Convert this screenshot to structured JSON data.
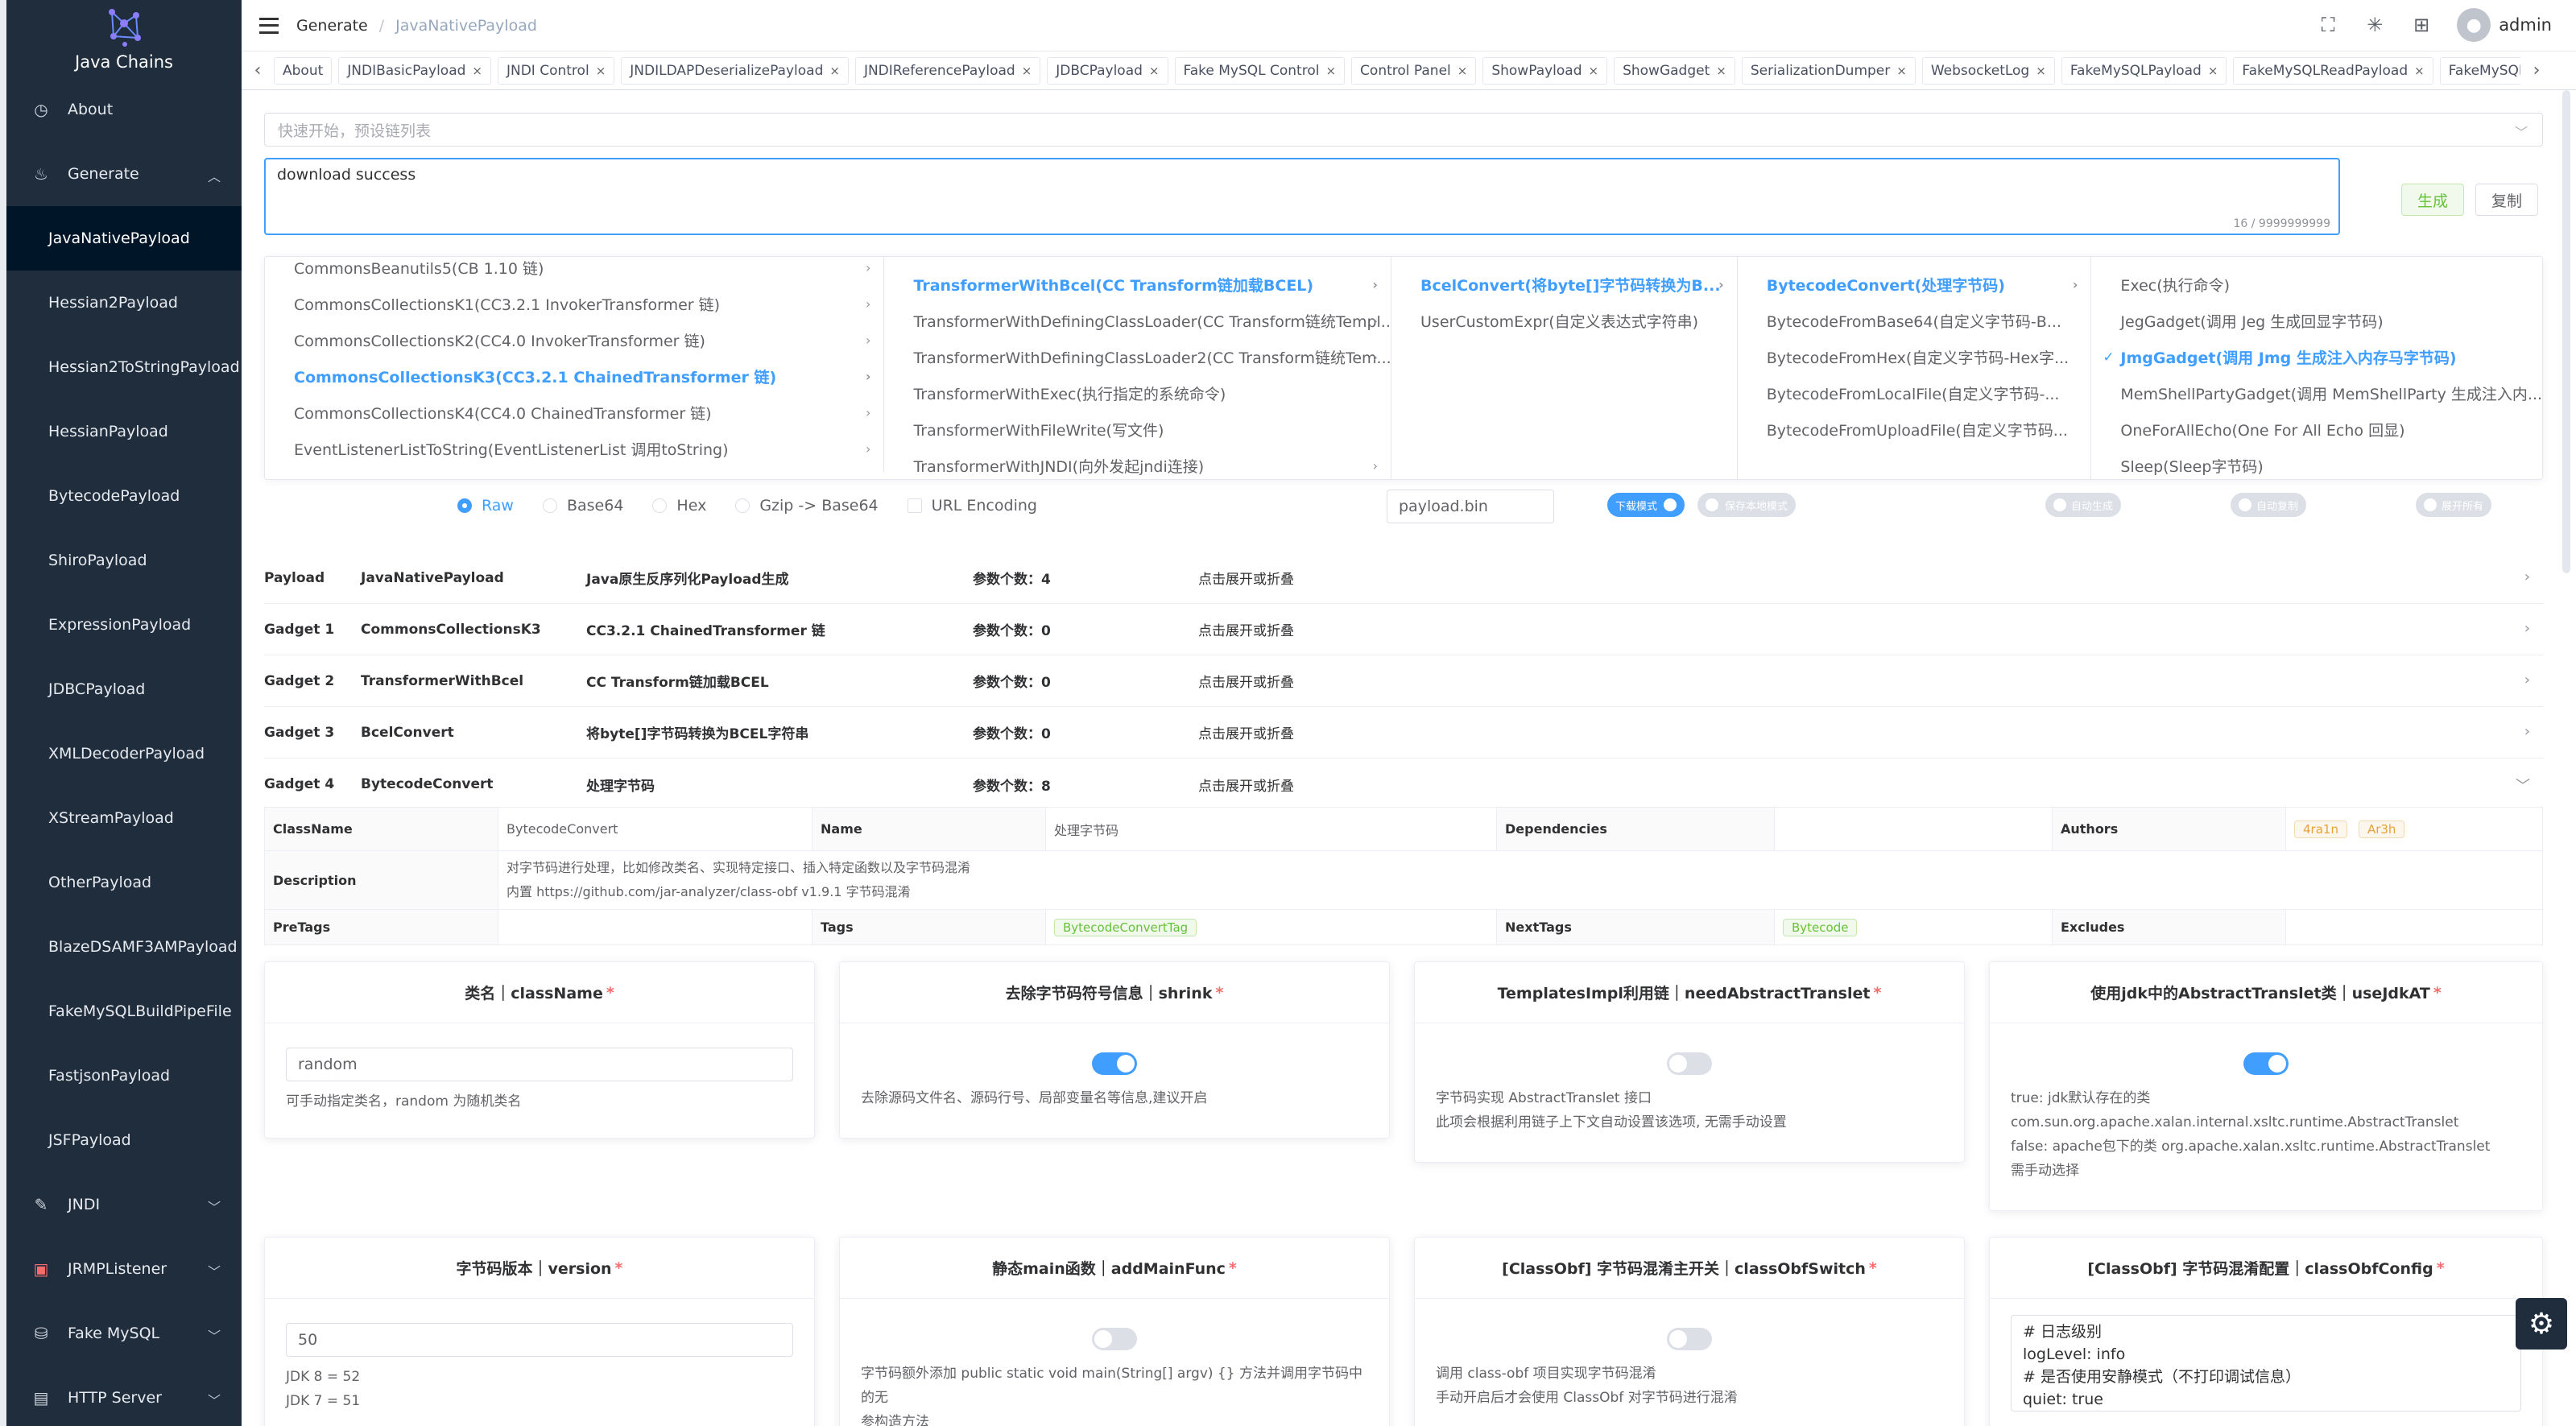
{
  "app": {
    "logo_text": "Java Chains",
    "user": "admin"
  },
  "sidebar": {
    "about": "About",
    "generate": "Generate",
    "sub_items": [
      "JavaNativePayload",
      "Hessian2Payload",
      "Hessian2ToStringPayload",
      "HessianPayload",
      "BytecodePayload",
      "ShiroPayload",
      "ExpressionPayload",
      "JDBCPayload",
      "XMLDecoderPayload",
      "XStreamPayload",
      "OtherPayload",
      "BlazeDSAMF3AMPayload",
      "FakeMySQLBuildPipeFile",
      "FastjsonPayload",
      "JSFPayload"
    ],
    "jndi": "JNDI",
    "jrmp": "JRMPListener",
    "fakemysql": "Fake MySQL",
    "http": "HTTP Server"
  },
  "breadcrumb": {
    "level1": "Generate",
    "level2": "JavaNativePayload"
  },
  "tags": [
    "About",
    "JNDIBasicPayload",
    "JNDI Control",
    "JNDILDAPDeserializePayload",
    "JNDIReferencePayload",
    "JDBCPayload",
    "Fake MySQL Control",
    "Control Panel",
    "ShowPayload",
    "ShowGadget",
    "SerializationDumper",
    "WebsocketLog",
    "FakeMySQLPayload",
    "FakeMySQLReadPayload",
    "FakeMySQLSHPayload"
  ],
  "main": {
    "select_placeholder": "快速开始，预设链列表",
    "output_text": "download success",
    "output_count": "16 / 9999999999",
    "generate_btn": "生成",
    "copy_btn": "复制"
  },
  "cascader": {
    "col1": [
      "CommonsBeanutils5(CB 1.10 链)",
      "CommonsCollectionsK1(CC3.2.1 InvokerTransformer 链)",
      "CommonsCollectionsK2(CC4.0 InvokerTransformer 链)",
      "CommonsCollectionsK3(CC3.2.1 ChainedTransformer 链)",
      "CommonsCollectionsK4(CC4.0 ChainedTransformer 链)",
      "EventListenerListToString(EventListenerList 调用toString)"
    ],
    "col2": [
      "TransformerWithBcel(CC Transform链加载BCEL)",
      "TransformerWithDefiningClassLoader(CC Transform链统Templ...",
      "TransformerWithDefiningClassLoader2(CC Transform链统Tem...",
      "TransformerWithExec(执行指定的系统命令)",
      "TransformerWithFileWrite(写文件)",
      "TransformerWithJNDI(向外发起jndi连接)"
    ],
    "col3": [
      "BcelConvert(将byte[]字节码转换为B...",
      "UserCustomExpr(自定义表达式字符串)"
    ],
    "col4": [
      "BytecodeConvert(处理字节码)",
      "BytecodeFromBase64(自定义字节码-B...",
      "BytecodeFromHex(自定义字节码-Hex字...",
      "BytecodeFromLocalFile(自定义字节码-...",
      "BytecodeFromUploadFile(自定义字节码..."
    ],
    "col5": [
      "Exec(执行命令)",
      "JegGadget(调用 Jeg 生成回显字节码)",
      "JmgGadget(调用 Jmg 生成注入内存马字节码)",
      "MemShellPartyGadget(调用 MemShellParty 生成注入内...",
      "OneForAllEcho(One For All Echo 回显)",
      "Sleep(Sleep字节码)"
    ]
  },
  "encoding": {
    "raw": "Raw",
    "base64": "Base64",
    "hex": "Hex",
    "gzip": "Gzip -> Base64",
    "url": "URL Encoding"
  },
  "file_name": "payload.bin",
  "switches": {
    "download": "下载模式",
    "local": "保存本地模式",
    "auto": "自动生成",
    "autoclip": "自动复制",
    "expand": "展开所有"
  },
  "gadgets": [
    {
      "label": "Payload",
      "name": "JavaNativePayload",
      "desc": "Java原生反序列化Payload生成",
      "params": "参数个数：4",
      "toggle": "点击展开或折叠"
    },
    {
      "label": "Gadget 1",
      "name": "CommonsCollectionsK3",
      "desc": "CC3.2.1 ChainedTransformer 链",
      "params": "参数个数：0",
      "toggle": "点击展开或折叠"
    },
    {
      "label": "Gadget 2",
      "name": "TransformerWithBcel",
      "desc": "CC Transform链加载BCEL",
      "params": "参数个数：0",
      "toggle": "点击展开或折叠"
    },
    {
      "label": "Gadget 3",
      "name": "BcelConvert",
      "desc": "将byte[]字节码转换为BCEL字符串",
      "params": "参数个数：0",
      "toggle": "点击展开或折叠"
    },
    {
      "label": "Gadget 4",
      "name": "BytecodeConvert",
      "desc": "处理字节码",
      "params": "参数个数：8",
      "toggle": "点击展开或折叠"
    }
  ],
  "details": {
    "classname_label": "ClassName",
    "classname": "BytecodeConvert",
    "name_label": "Name",
    "name": "处理字节码",
    "deps_label": "Dependencies",
    "authors_label": "Authors",
    "authors": [
      "4ra1n",
      "Ar3h"
    ],
    "desc_label": "Description",
    "desc1": "对字节码进行处理，比如修改类名、实现特定接口、插入特定函数以及字节码混淆",
    "desc2": "内置 https://github.com/jar-analyzer/class-obf v1.9.1 字节码混淆",
    "pretags_label": "PreTags",
    "tags_label": "Tags",
    "tags": "BytecodeConvertTag",
    "nexttags_label": "NextTags",
    "nexttags": "Bytecode",
    "excludes_label": "Excludes"
  },
  "cards": {
    "classname": {
      "title": "类名｜className",
      "value": "random",
      "help": "可手动指定类名，random 为随机类名"
    },
    "shrink": {
      "title": "去除字节码符号信息｜shrink",
      "help": "去除源码文件名、源码行号、局部变量名等信息,建议开启"
    },
    "abstract": {
      "title": "TemplatesImpl利用链｜needAbstractTranslet",
      "help1": "字节码实现 AbstractTranslet 接口",
      "help2": "此项会根据利用链子上下文自动设置该选项, 无需手动设置"
    },
    "usejdk": {
      "title": "使用jdk中的AbstractTranslet类｜useJdkAT",
      "h1": "true: jdk默认存在的类",
      "h2": "com.sun.org.apache.xalan.internal.xsltc.runtime.AbstractTranslet",
      "h3": "false: apache包下的类 org.apache.xalan.xsltc.runtime.AbstractTranslet",
      "h4": "需手动选择"
    },
    "version": {
      "title": "字节码版本｜version",
      "value": "50",
      "h1": "JDK 8 = 52",
      "h2": "JDK 7 = 51"
    },
    "mainfunc": {
      "title": "静态main函数｜addMainFunc",
      "h1": "字节码额外添加 public static void main(String[] argv) {} 方法并调用字节码中的无",
      "h2": "参构造方法"
    },
    "obfswitch": {
      "title": "[ClassObf] 字节码混淆主开关｜classObfSwitch",
      "h1": "调用 class-obf 项目实现字节码混淆",
      "h2": "手动开启后才会使用 ClassObf 对字节码进行混淆"
    },
    "obfconfig": {
      "title": "[ClassObf] 字节码混淆配置｜classObfConfig",
      "l1": "# 日志级别",
      "l2": "logLevel: info",
      "l3": "# 是否使用安静模式（不打印调试信息）",
      "l4": "quiet: true"
    }
  }
}
